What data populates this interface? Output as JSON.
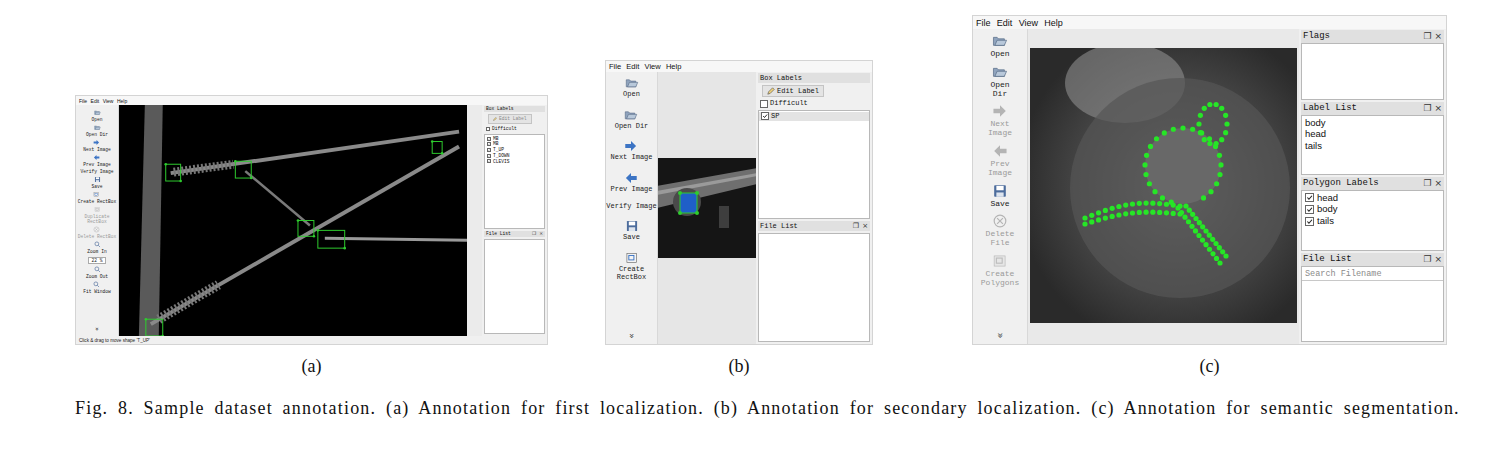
{
  "subfigures": [
    {
      "kind": "labelimg",
      "caption": "(a)",
      "menu": [
        "File",
        "Edit",
        "View",
        "Help"
      ],
      "toolbar": [
        {
          "label": "Open",
          "kind": "open",
          "disabled": false
        },
        {
          "label": "Open Dir",
          "kind": "open",
          "disabled": false
        },
        {
          "label": "Next Image",
          "kind": "next",
          "disabled": false
        },
        {
          "label": "Prev Image",
          "kind": "prev",
          "disabled": false
        },
        {
          "label": "Verify Image",
          "kind": "text",
          "disabled": false
        },
        {
          "label": "Save",
          "kind": "save",
          "disabled": false
        },
        {
          "label": "Create RectBox",
          "kind": "create",
          "disabled": false
        },
        {
          "label": "Duplicate RectBox",
          "kind": "create",
          "disabled": true
        },
        {
          "label": "Delete RectBox",
          "kind": "delete",
          "disabled": true
        },
        {
          "label": "Zoom In",
          "kind": "zoom",
          "disabled": false
        },
        {
          "label": "22 %",
          "kind": "field",
          "disabled": false
        },
        {
          "label": "Zoom Out",
          "kind": "zoom",
          "disabled": false
        },
        {
          "label": "Fit Window",
          "kind": "zoom",
          "disabled": false
        }
      ],
      "more": "»",
      "box_labels": {
        "title": "Box Labels",
        "edit_button": "Edit Label",
        "edit_disabled": true,
        "difficult": {
          "label": "Difficult",
          "checked": false
        },
        "items": [
          {
            "label": "MB",
            "checked": true,
            "selected": false
          },
          {
            "label": "MB",
            "checked": true,
            "selected": false
          },
          {
            "label": "T_UP",
            "checked": true,
            "selected": false
          },
          {
            "label": "T_DOWN",
            "checked": true,
            "selected": false
          },
          {
            "label": "CLEVIS",
            "checked": true,
            "selected": false
          }
        ]
      },
      "file_list": {
        "title": "File List",
        "dock_buttons": [
          "❐",
          "×"
        ]
      },
      "status": "Click & drag to move shape 'T_UP'"
    },
    {
      "kind": "labelimg",
      "caption": "(b)",
      "menu": [
        "File",
        "Edit",
        "View",
        "Help"
      ],
      "toolbar": [
        {
          "label": "Open",
          "kind": "open",
          "disabled": false
        },
        {
          "label": "Open Dir",
          "kind": "open",
          "disabled": false
        },
        {
          "label": "Next Image",
          "kind": "next",
          "disabled": false
        },
        {
          "label": "Prev Image",
          "kind": "prev",
          "disabled": false
        },
        {
          "label": "Verify Image",
          "kind": "text",
          "disabled": false
        },
        {
          "label": "Save",
          "kind": "save",
          "disabled": false
        },
        {
          "label": "Create RectBox",
          "kind": "create",
          "disabled": false
        }
      ],
      "more": "»",
      "box_labels": {
        "title": "Box Labels",
        "edit_button": "Edit Label",
        "edit_disabled": false,
        "difficult": {
          "label": "Difficult",
          "checked": false
        },
        "items": [
          {
            "label": "SP",
            "checked": true,
            "selected": true
          }
        ]
      },
      "file_list": {
        "title": "File List",
        "dock_buttons": [
          "❐",
          "×"
        ]
      },
      "status": ""
    },
    {
      "kind": "labelme",
      "caption": "(c)",
      "menu": [
        "File",
        "Edit",
        "View",
        "Help"
      ],
      "toolbar": [
        {
          "label": "Open",
          "kind": "open",
          "disabled": false
        },
        {
          "label": "Open Dir",
          "kind": "open",
          "disabled": false
        },
        {
          "label": "Next Image",
          "kind": "next",
          "disabled": true
        },
        {
          "label": "Prev Image",
          "kind": "prev",
          "disabled": true
        },
        {
          "label": "Save",
          "kind": "save",
          "disabled": false
        },
        {
          "label": "Delete File",
          "kind": "delete",
          "disabled": true
        },
        {
          "label": "Create Polygons",
          "kind": "create",
          "disabled": true
        }
      ],
      "more": "»",
      "docks": [
        {
          "title": "Flags",
          "kind": "empty",
          "dock_buttons": [
            "❐",
            "×"
          ],
          "items": []
        },
        {
          "title": "Label List",
          "kind": "list",
          "dock_buttons": [
            "❐",
            "×"
          ],
          "items": [
            {
              "label": "body",
              "selected": false
            },
            {
              "label": "head",
              "selected": false
            },
            {
              "label": "tails",
              "selected": false
            }
          ]
        },
        {
          "title": "Polygon Labels",
          "kind": "checklist",
          "dock_buttons": [
            "❐",
            "×"
          ],
          "items": [
            {
              "label": "head",
              "checked": true,
              "selected": false
            },
            {
              "label": "body",
              "checked": true,
              "selected": false
            },
            {
              "label": "tails",
              "checked": true,
              "selected": false
            }
          ]
        },
        {
          "title": "File List",
          "kind": "search",
          "dock_buttons": [
            "❐",
            "×"
          ],
          "placeholder": "Search Filename",
          "items": []
        }
      ]
    }
  ],
  "figure_caption": "Fig. 8.  Sample dataset annotation. (a) Annotation for first localization. (b) Annotation for secondary localization. (c) Annotation for semantic segmentation."
}
